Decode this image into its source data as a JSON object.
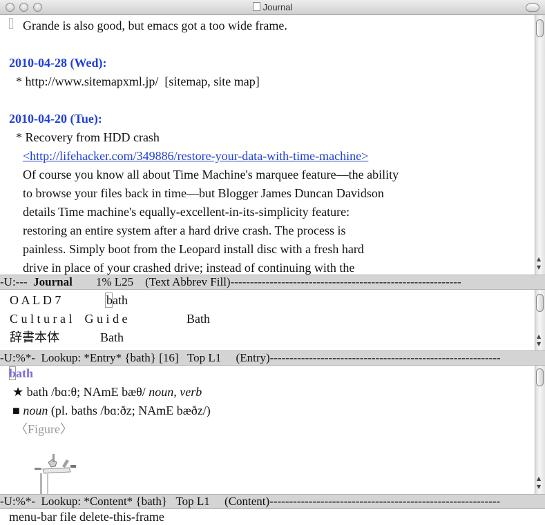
{
  "app": {
    "window_title": "Journal"
  },
  "journal": {
    "lines": [
      {
        "text": "Grande is also good, but emacs got a too wide frame.",
        "indent": 33,
        "kind": "text"
      },
      {
        "text": "",
        "indent": 0,
        "kind": "text"
      },
      {
        "text": "2010-04-28 (Wed):",
        "indent": 13,
        "kind": "date"
      },
      {
        "text": "* http://www.sitemapxml.jp/  [sitemap, site map]",
        "indent": 23,
        "kind": "text"
      },
      {
        "text": "",
        "indent": 0,
        "kind": "text"
      },
      {
        "text": "2010-04-20 (Tue):",
        "indent": 13,
        "kind": "date"
      },
      {
        "text": "* Recovery from HDD crash",
        "indent": 23,
        "kind": "text"
      },
      {
        "text": "<http://lifehacker.com/349886/restore-your-data-with-time-machine>",
        "indent": 33,
        "kind": "link"
      },
      {
        "text": "Of course you know all about Time Machine's marquee feature—the ability",
        "indent": 33,
        "kind": "text"
      },
      {
        "text": "to browse your files back in time—but Blogger James Duncan Davidson",
        "indent": 33,
        "kind": "text"
      },
      {
        "text": "details Time machine's equally-excellent-in-its-simplicity feature:",
        "indent": 33,
        "kind": "text"
      },
      {
        "text": "restoring an entire system after a hard drive crash. The process is",
        "indent": 33,
        "kind": "text"
      },
      {
        "text": "painless. Simply boot from the Leopard install disc with a fresh hard",
        "indent": 33,
        "kind": "text"
      },
      {
        "text": "drive in place of your crashed drive; instead of continuing with the",
        "indent": 33,
        "kind": "text"
      }
    ]
  },
  "modeline1": {
    "prefix": "-U:---  ",
    "buffer": "Journal",
    "rest": "        1% L25    (Text Abbrev Fill)-----------------------------------------------------------"
  },
  "entry": {
    "rows": [
      {
        "dict": "O A L D 7",
        "word": "bath"
      },
      {
        "dict": "C u l t u r a l    G u i d e",
        "word": "Bath"
      },
      {
        "dict": "辞書本体",
        "word": "Bath"
      }
    ]
  },
  "modeline2": {
    "text": "-U:%*-  Lookup: *Entry* {bath} [16]   Top L1     (Entry)-----------------------------------------------------------"
  },
  "content": {
    "headword": "bath",
    "line1_marker": "★",
    "line1_pre": " bath /bɑːθ; NAmE bæθ/ ",
    "line1_pos": "noun, verb",
    "line2_marker": "■",
    "line2_pos": "noun",
    "line2_rest": " (pl. baths /bɑːðz; NAmE bæðz/)",
    "figure_label": "〈Figure〉"
  },
  "modeline3": {
    "text": "-U:%*-  Lookup: *Content* {bath}   Top L1     (Content)-----------------------------------------------------------"
  },
  "echo_area": {
    "text": "menu-bar file delete-this-frame"
  }
}
